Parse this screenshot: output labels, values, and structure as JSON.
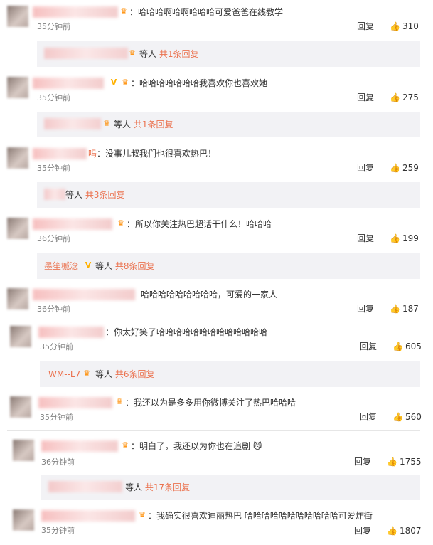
{
  "common": {
    "reply": "回复",
    "thumb_icon": "thumbs-up-icon",
    "crown_icon": "crown-badge-icon",
    "v_icon": "v-badge-icon"
  },
  "comments": [
    {
      "text": "：哈哈哈啊哈啊哈哈哈可爱爸爸在线教学",
      "time": "35分钟前",
      "likes": "310",
      "reply_summary": {
        "suffix": "等人",
        "count": "共1条回复"
      }
    },
    {
      "text": "：哈哈哈哈哈哈哈我喜欢你也喜欢她",
      "time": "35分钟前",
      "likes": "275",
      "reply_summary": {
        "suffix": "等人",
        "count": "共1条回复"
      }
    },
    {
      "name_tail": "吗",
      "text": "：没事儿叔我们也很喜欢热巴！",
      "time": "35分钟前",
      "likes": "259",
      "reply_summary": {
        "suffix": "等人",
        "count": "共3条回复"
      }
    },
    {
      "text": "：所以你关注热巴超话干什么！哈哈哈",
      "time": "36分钟前",
      "likes": "199",
      "reply_summary": {
        "name": "墨笙槭淰",
        "suffix": "等人",
        "count": "共8条回复"
      }
    },
    {
      "text": "哈哈哈哈哈哈哈哈哈，可爱的一家人",
      "time": "36分钟前",
      "likes": "187"
    },
    {
      "text": "：你太好笑了哈哈哈哈哈哈哈哈哈哈哈哈哈",
      "time": "35分钟前",
      "likes": "605",
      "reply_summary": {
        "name": "WM--L7",
        "suffix": "等人",
        "count": "共6条回复"
      }
    },
    {
      "text": "：我还以为是多多用你微博关注了热巴哈哈哈",
      "time": "35分钟前",
      "likes": "560"
    },
    {
      "text": "：明白了，我还以为你也在追剧",
      "emoji": "😼",
      "time": "36分钟前",
      "likes": "1755",
      "reply_summary": {
        "suffix": "等人",
        "count": "共17条回复"
      }
    },
    {
      "text": "：我确实很喜欢迪丽热巴 哈哈哈哈哈哈哈哈哈哈哈可爱炸街",
      "time": "35分钟前",
      "likes": "1807"
    }
  ]
}
